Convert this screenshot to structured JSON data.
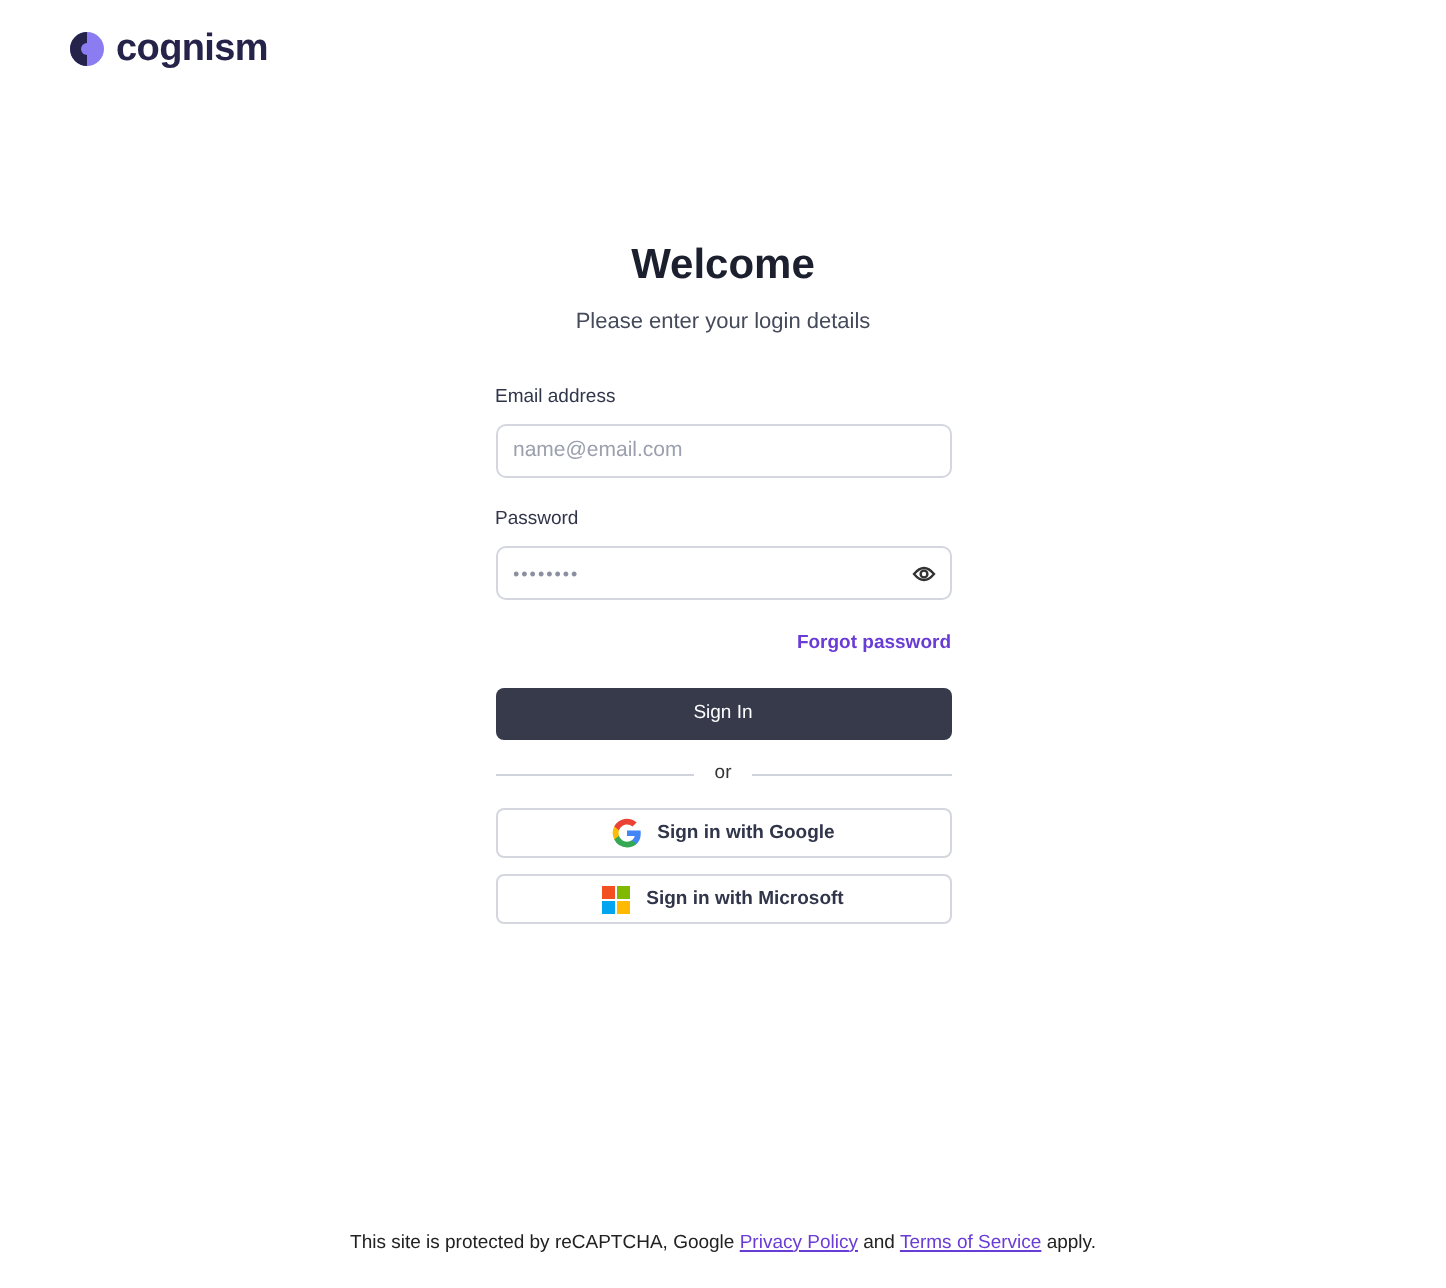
{
  "logo": {
    "text": "cognism"
  },
  "heading": "Welcome",
  "subheading": "Please enter your login details",
  "email": {
    "label": "Email address",
    "placeholder": "name@email.com"
  },
  "password": {
    "label": "Password",
    "value": "••••••••",
    "revealed": false
  },
  "forgot_link": "Forgot password",
  "sign_in_button": "Sign In",
  "divider_text": "or",
  "sso_buttons": [
    {
      "kind": "google",
      "label": "Sign in with Google"
    },
    {
      "kind": "microsoft",
      "label": "Sign in with Microsoft"
    }
  ],
  "footer": {
    "before": "This site is protected by reCAPTCHA, Google",
    "privacy_link": "Privacy Policy",
    "middle": "and",
    "terms_link": "Terms of Service",
    "after": "apply."
  }
}
